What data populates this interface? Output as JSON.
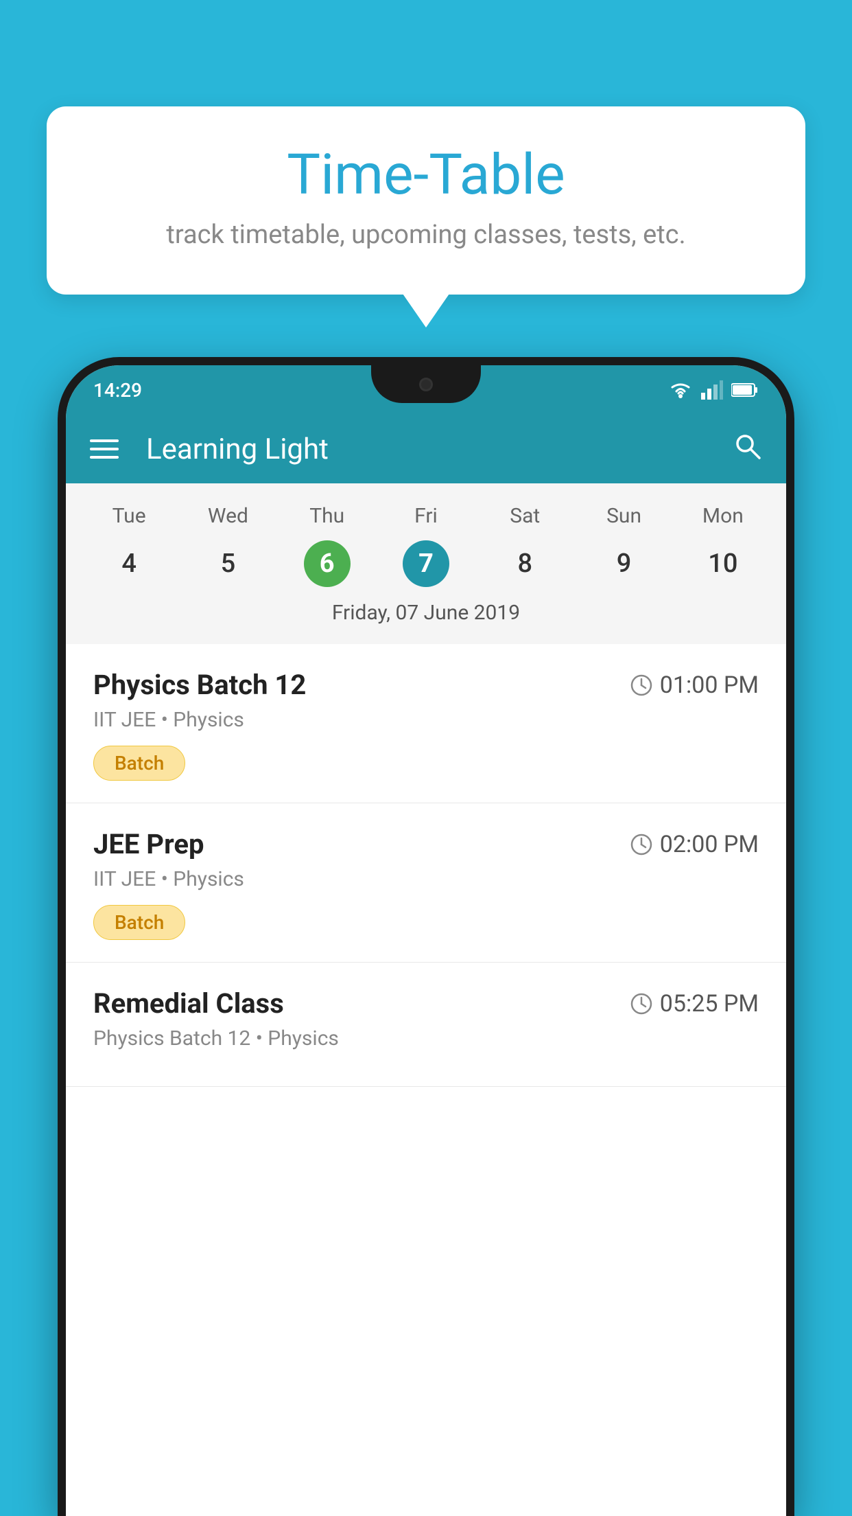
{
  "page": {
    "background_color": "#29b6d8"
  },
  "bubble": {
    "title": "Time-Table",
    "subtitle": "track timetable, upcoming classes, tests, etc."
  },
  "status_bar": {
    "time": "14:29"
  },
  "app_bar": {
    "title": "Learning Light"
  },
  "calendar": {
    "days": [
      "Tue",
      "Wed",
      "Thu",
      "Fri",
      "Sat",
      "Sun",
      "Mon"
    ],
    "dates": [
      "4",
      "5",
      "6",
      "7",
      "8",
      "9",
      "10"
    ],
    "today_index": 2,
    "selected_index": 3,
    "selected_date_label": "Friday, 07 June 2019"
  },
  "schedule": {
    "items": [
      {
        "title": "Physics Batch 12",
        "time": "01:00 PM",
        "subtitle": "IIT JEE • Physics",
        "badge": "Batch"
      },
      {
        "title": "JEE Prep",
        "time": "02:00 PM",
        "subtitle": "IIT JEE • Physics",
        "badge": "Batch"
      },
      {
        "title": "Remedial Class",
        "time": "05:25 PM",
        "subtitle": "Physics Batch 12 • Physics",
        "badge": null
      }
    ]
  }
}
